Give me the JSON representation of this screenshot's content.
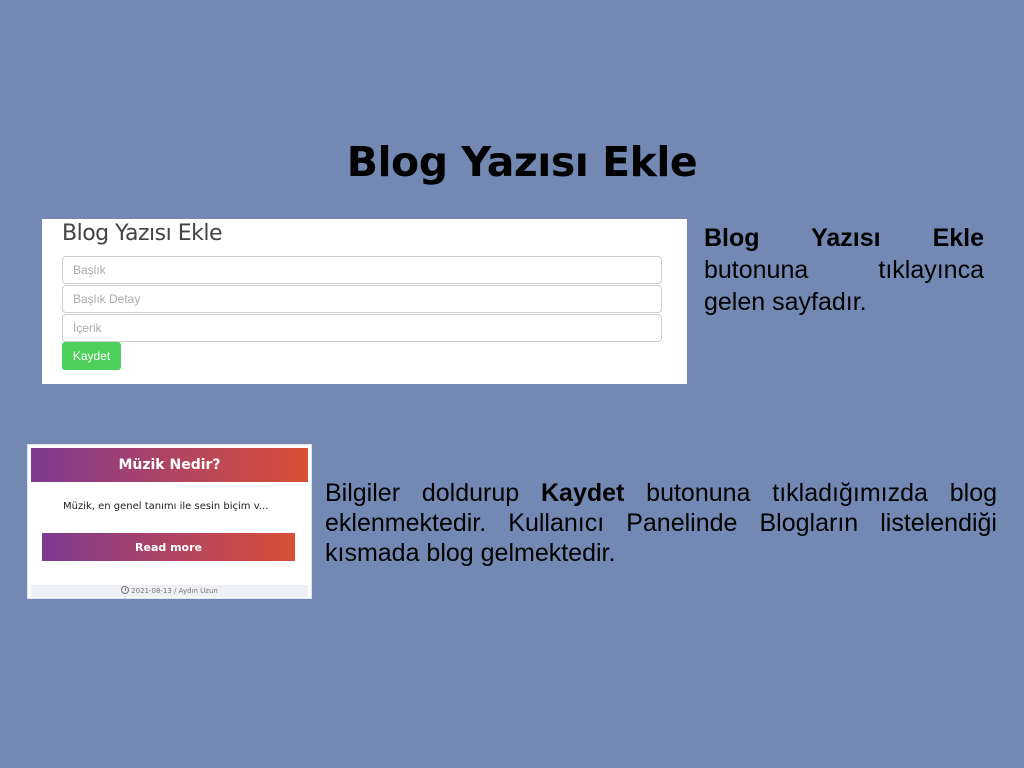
{
  "slide": {
    "title": "Blog Yazısı Ekle"
  },
  "form": {
    "heading": "Blog Yazısı Ekle",
    "fields": [
      {
        "placeholder": "Başlık"
      },
      {
        "placeholder": "Başlık Detay"
      },
      {
        "placeholder": "İçerik"
      }
    ],
    "save_label": "Kaydet"
  },
  "desc1": {
    "bold": "Blog Yazısı Ekle",
    "rest": " butonuna tıklayınca gelen sayfadır."
  },
  "card": {
    "title": "Müzik Nedir?",
    "excerpt": "Müzik, en genel tanımı ile sesin biçim v...",
    "read_more": "Read more",
    "meta": "2021-08-13 / Aydın Uzun"
  },
  "desc2": {
    "before": "Bilgiler doldurup ",
    "bold": "Kaydet",
    "after": " butonuna tıkladığımızda blog eklenmektedir. Kullanıcı Panelinde Blogların listelendiği kısmada blog gelmektedir."
  },
  "colors": {
    "background": "#7389b4",
    "save_button": "#4cd05a",
    "gradient_start": "#7d3a92",
    "gradient_end": "#d94f37"
  }
}
